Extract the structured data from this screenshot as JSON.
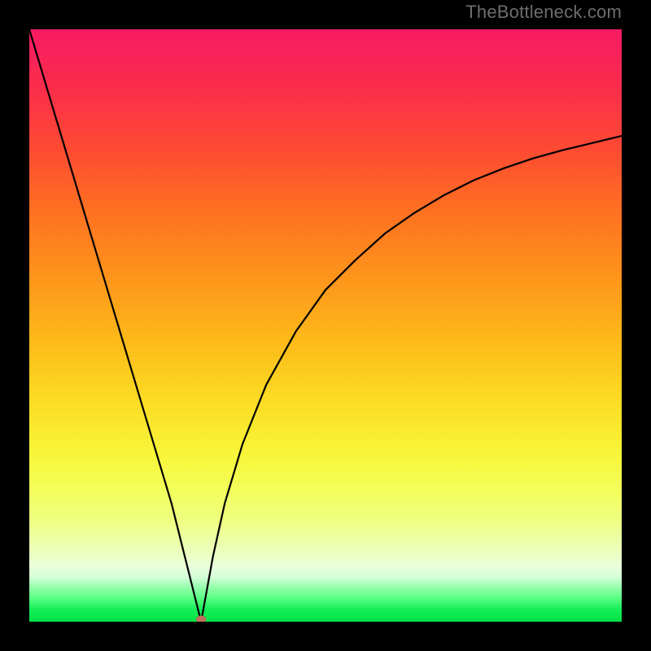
{
  "watermark": "TheBottleneck.com",
  "colors": {
    "frame": "#000000",
    "curve": "#000000",
    "vertex_dot": "#c0705c",
    "gradient_stops": [
      "#f81a63",
      "#fb2d4b",
      "#fd4a33",
      "#fe6e22",
      "#fe951b",
      "#fdbb1a",
      "#fbdd24",
      "#f8f63a",
      "#f2ff5c",
      "#eeff82",
      "#ecffb0",
      "#eaffd8",
      "#d4ffd8",
      "#9cffb0",
      "#5aff84",
      "#14ed56",
      "#00e246"
    ]
  },
  "chart_data": {
    "type": "line",
    "title": "",
    "xlabel": "",
    "ylabel": "",
    "xlim": [
      0,
      100
    ],
    "ylim": [
      0,
      100
    ],
    "grid": false,
    "legend": false,
    "description": "V-shaped curve with a sharp minimum at x≈29, left branch nearly linear descending from top-left, right branch rising with decreasing slope (concave) toward upper right.",
    "vertex": {
      "x": 29,
      "y": 0
    },
    "series": [
      {
        "name": "left-branch",
        "x": [
          0,
          3,
          6,
          9,
          12,
          15,
          18,
          21,
          24,
          27,
          29
        ],
        "y": [
          100,
          90,
          80,
          70,
          60,
          50,
          40,
          30,
          20,
          8,
          0
        ]
      },
      {
        "name": "right-branch",
        "x": [
          29,
          31,
          33,
          36,
          40,
          45,
          50,
          55,
          60,
          65,
          70,
          75,
          80,
          85,
          90,
          95,
          100
        ],
        "y": [
          0,
          11,
          20,
          30,
          40,
          49,
          56,
          61,
          65.5,
          69,
          72,
          74.5,
          76.5,
          78.2,
          79.6,
          80.8,
          82
        ]
      }
    ]
  }
}
